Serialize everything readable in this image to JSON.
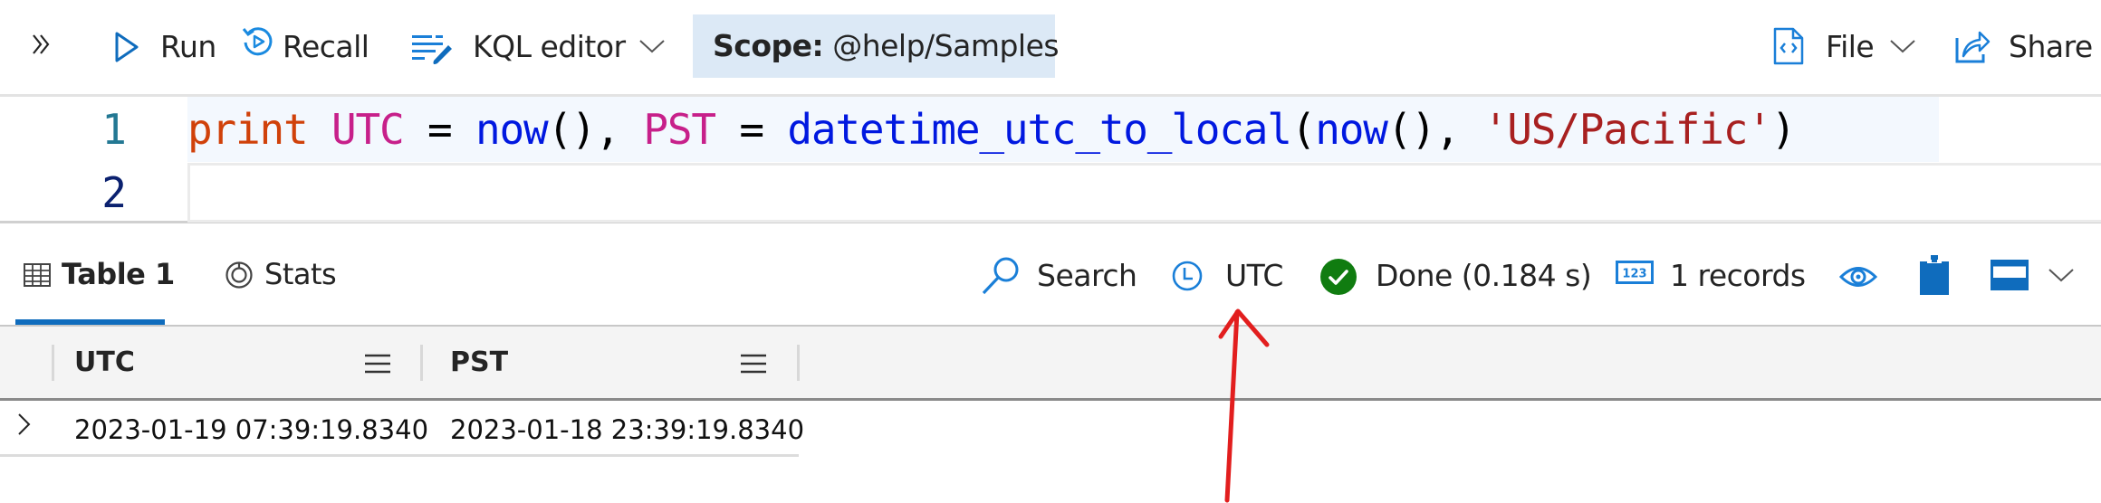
{
  "toolbar": {
    "expand_icon": "double-chevron-right-icon",
    "run_label": "Run",
    "recall_label": "Recall",
    "editor_mode_label": "KQL editor",
    "scope_prefix": "Scope:",
    "scope_value": "@help/Samples",
    "file_label": "File",
    "share_label": "Share"
  },
  "editor": {
    "line_numbers": [
      "1",
      "2"
    ],
    "tokens": [
      {
        "text": "print",
        "kind": "kw"
      },
      {
        "text": " ",
        "kind": "pl"
      },
      {
        "text": "UTC",
        "kind": "var"
      },
      {
        "text": " = ",
        "kind": "pl"
      },
      {
        "text": "now",
        "kind": "fn"
      },
      {
        "text": "(), ",
        "kind": "pl"
      },
      {
        "text": "PST",
        "kind": "var"
      },
      {
        "text": " = ",
        "kind": "pl"
      },
      {
        "text": "datetime_utc_to_local",
        "kind": "fn"
      },
      {
        "text": "(",
        "kind": "pl"
      },
      {
        "text": "now",
        "kind": "fn"
      },
      {
        "text": "(), ",
        "kind": "pl"
      },
      {
        "text": "'US/Pacific'",
        "kind": "str"
      },
      {
        "text": ")",
        "kind": "pl"
      }
    ]
  },
  "results": {
    "tabs": [
      {
        "label": "Table 1",
        "icon": "table-icon",
        "active": true
      },
      {
        "label": "Stats",
        "icon": "stats-donut-icon",
        "active": false
      }
    ],
    "search_label": "Search",
    "timezone_label": "UTC",
    "status_label": "Done (0.184 s)",
    "records_label": "1 records"
  },
  "grid": {
    "columns": [
      "UTC",
      "PST"
    ],
    "rows": [
      [
        "2023-01-19 07:39:19.8340",
        "2023-01-18 23:39:19.8340"
      ]
    ]
  },
  "annotation": {
    "type": "red-arrow",
    "color": "#e21e1e",
    "points_to": "timezone-UTC-button"
  },
  "colors": {
    "accent": "#0f6cbd",
    "success": "#107c10",
    "scope_bg": "#dce9f6"
  }
}
